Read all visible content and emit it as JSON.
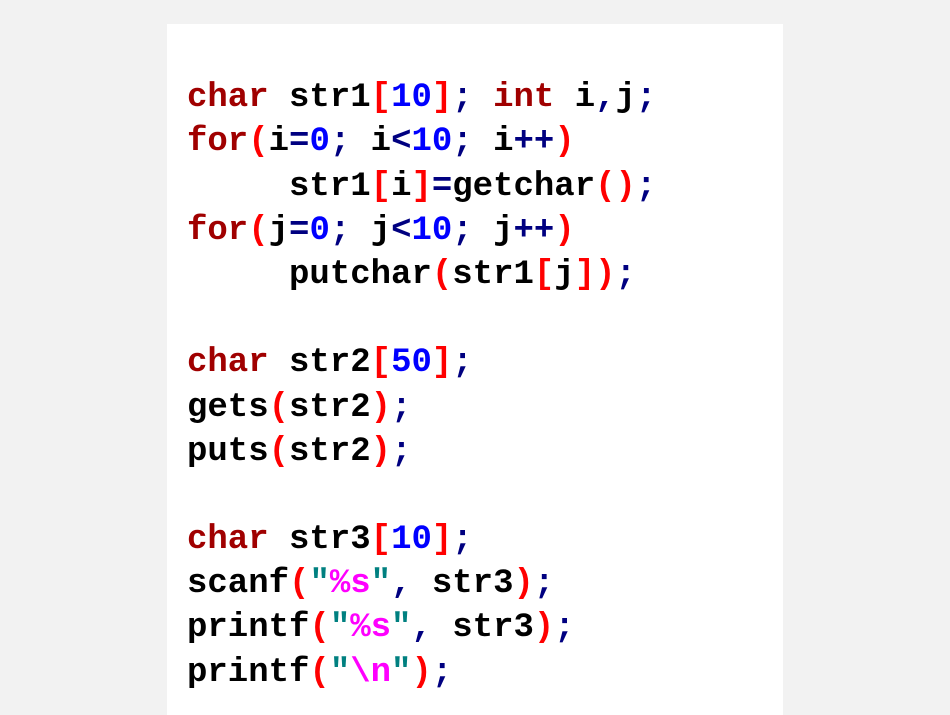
{
  "code": {
    "lines": [
      {
        "indent": 0,
        "tokens": [
          {
            "cls": "t-type",
            "t": "char"
          },
          {
            "cls": "",
            "t": " "
          },
          {
            "cls": "t-ident",
            "t": "str1"
          },
          {
            "cls": "t-bracket",
            "t": "["
          },
          {
            "cls": "t-number",
            "t": "10"
          },
          {
            "cls": "t-bracket",
            "t": "]"
          },
          {
            "cls": "t-op",
            "t": ";"
          },
          {
            "cls": "",
            "t": " "
          },
          {
            "cls": "t-type",
            "t": "int"
          },
          {
            "cls": "",
            "t": " "
          },
          {
            "cls": "t-ident",
            "t": "i"
          },
          {
            "cls": "t-op",
            "t": ","
          },
          {
            "cls": "t-ident",
            "t": "j"
          },
          {
            "cls": "t-op",
            "t": ";"
          }
        ]
      },
      {
        "indent": 0,
        "tokens": [
          {
            "cls": "t-keyword",
            "t": "for"
          },
          {
            "cls": "t-bracket",
            "t": "("
          },
          {
            "cls": "t-ident",
            "t": "i"
          },
          {
            "cls": "t-op",
            "t": "="
          },
          {
            "cls": "t-number",
            "t": "0"
          },
          {
            "cls": "t-op",
            "t": ";"
          },
          {
            "cls": "",
            "t": " "
          },
          {
            "cls": "t-ident",
            "t": "i"
          },
          {
            "cls": "t-op",
            "t": "<"
          },
          {
            "cls": "t-number",
            "t": "10"
          },
          {
            "cls": "t-op",
            "t": ";"
          },
          {
            "cls": "",
            "t": " "
          },
          {
            "cls": "t-ident",
            "t": "i"
          },
          {
            "cls": "t-op",
            "t": "++"
          },
          {
            "cls": "t-bracket",
            "t": ")"
          }
        ]
      },
      {
        "indent": 1,
        "tokens": [
          {
            "cls": "t-ident",
            "t": "str1"
          },
          {
            "cls": "t-bracket",
            "t": "["
          },
          {
            "cls": "t-ident",
            "t": "i"
          },
          {
            "cls": "t-bracket",
            "t": "]"
          },
          {
            "cls": "t-op",
            "t": "="
          },
          {
            "cls": "t-func",
            "t": "getchar"
          },
          {
            "cls": "t-bracket",
            "t": "("
          },
          {
            "cls": "t-bracket",
            "t": ")"
          },
          {
            "cls": "t-op",
            "t": ";"
          }
        ]
      },
      {
        "indent": 0,
        "tokens": [
          {
            "cls": "t-keyword",
            "t": "for"
          },
          {
            "cls": "t-bracket",
            "t": "("
          },
          {
            "cls": "t-ident",
            "t": "j"
          },
          {
            "cls": "t-op",
            "t": "="
          },
          {
            "cls": "t-number",
            "t": "0"
          },
          {
            "cls": "t-op",
            "t": ";"
          },
          {
            "cls": "",
            "t": " "
          },
          {
            "cls": "t-ident",
            "t": "j"
          },
          {
            "cls": "t-op",
            "t": "<"
          },
          {
            "cls": "t-number",
            "t": "10"
          },
          {
            "cls": "t-op",
            "t": ";"
          },
          {
            "cls": "",
            "t": " "
          },
          {
            "cls": "t-ident",
            "t": "j"
          },
          {
            "cls": "t-op",
            "t": "++"
          },
          {
            "cls": "t-bracket",
            "t": ")"
          }
        ]
      },
      {
        "indent": 1,
        "tokens": [
          {
            "cls": "t-func",
            "t": "putchar"
          },
          {
            "cls": "t-bracket",
            "t": "("
          },
          {
            "cls": "t-ident",
            "t": "str1"
          },
          {
            "cls": "t-bracket",
            "t": "["
          },
          {
            "cls": "t-ident",
            "t": "j"
          },
          {
            "cls": "t-bracket",
            "t": "]"
          },
          {
            "cls": "t-bracket",
            "t": ")"
          },
          {
            "cls": "t-op",
            "t": ";"
          }
        ]
      },
      {
        "indent": 0,
        "tokens": []
      },
      {
        "indent": 0,
        "tokens": [
          {
            "cls": "t-type",
            "t": "char"
          },
          {
            "cls": "",
            "t": " "
          },
          {
            "cls": "t-ident",
            "t": "str2"
          },
          {
            "cls": "t-bracket",
            "t": "["
          },
          {
            "cls": "t-number",
            "t": "50"
          },
          {
            "cls": "t-bracket",
            "t": "]"
          },
          {
            "cls": "t-op",
            "t": ";"
          }
        ]
      },
      {
        "indent": 0,
        "tokens": [
          {
            "cls": "t-func",
            "t": "gets"
          },
          {
            "cls": "t-bracket",
            "t": "("
          },
          {
            "cls": "t-ident",
            "t": "str2"
          },
          {
            "cls": "t-bracket",
            "t": ")"
          },
          {
            "cls": "t-op",
            "t": ";"
          }
        ]
      },
      {
        "indent": 0,
        "tokens": [
          {
            "cls": "t-func",
            "t": "puts"
          },
          {
            "cls": "t-bracket",
            "t": "("
          },
          {
            "cls": "t-ident",
            "t": "str2"
          },
          {
            "cls": "t-bracket",
            "t": ")"
          },
          {
            "cls": "t-op",
            "t": ";"
          }
        ]
      },
      {
        "indent": 0,
        "tokens": []
      },
      {
        "indent": 0,
        "tokens": [
          {
            "cls": "t-type",
            "t": "char"
          },
          {
            "cls": "",
            "t": " "
          },
          {
            "cls": "t-ident",
            "t": "str3"
          },
          {
            "cls": "t-bracket",
            "t": "["
          },
          {
            "cls": "t-number",
            "t": "10"
          },
          {
            "cls": "t-bracket",
            "t": "]"
          },
          {
            "cls": "t-op",
            "t": ";"
          }
        ]
      },
      {
        "indent": 0,
        "tokens": [
          {
            "cls": "t-func",
            "t": "scanf"
          },
          {
            "cls": "t-bracket",
            "t": "("
          },
          {
            "cls": "t-string",
            "t": "\""
          },
          {
            "cls": "t-esc",
            "t": "%s"
          },
          {
            "cls": "t-string",
            "t": "\""
          },
          {
            "cls": "t-op",
            "t": ","
          },
          {
            "cls": "",
            "t": " "
          },
          {
            "cls": "t-ident",
            "t": "str3"
          },
          {
            "cls": "t-bracket",
            "t": ")"
          },
          {
            "cls": "t-op",
            "t": ";"
          }
        ]
      },
      {
        "indent": 0,
        "tokens": [
          {
            "cls": "t-func",
            "t": "printf"
          },
          {
            "cls": "t-bracket",
            "t": "("
          },
          {
            "cls": "t-string",
            "t": "\""
          },
          {
            "cls": "t-esc",
            "t": "%s"
          },
          {
            "cls": "t-string",
            "t": "\""
          },
          {
            "cls": "t-op",
            "t": ","
          },
          {
            "cls": "",
            "t": " "
          },
          {
            "cls": "t-ident",
            "t": "str3"
          },
          {
            "cls": "t-bracket",
            "t": ")"
          },
          {
            "cls": "t-op",
            "t": ";"
          }
        ]
      },
      {
        "indent": 0,
        "tokens": [
          {
            "cls": "t-func",
            "t": "printf"
          },
          {
            "cls": "t-bracket",
            "t": "("
          },
          {
            "cls": "t-string",
            "t": "\""
          },
          {
            "cls": "t-esc",
            "t": "\\n"
          },
          {
            "cls": "t-string",
            "t": "\""
          },
          {
            "cls": "t-bracket",
            "t": ")"
          },
          {
            "cls": "t-op",
            "t": ";"
          }
        ]
      }
    ]
  }
}
